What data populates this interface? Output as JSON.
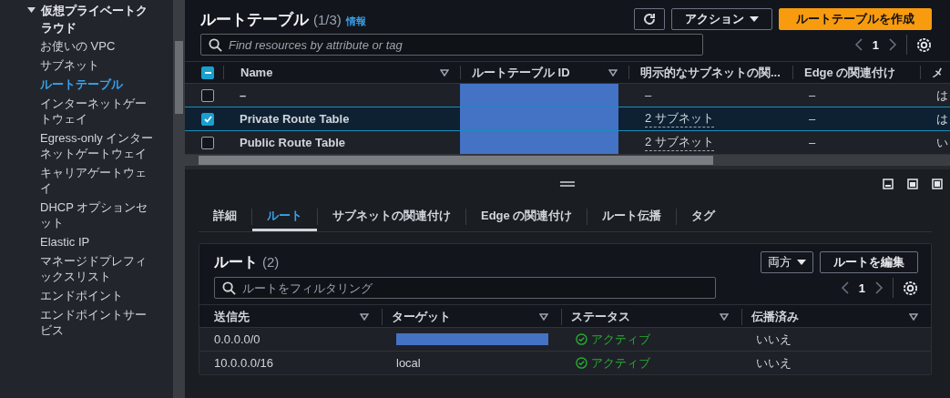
{
  "sidebar": {
    "group": {
      "label": "仮想プライベートクラウド",
      "expanded": true
    },
    "items": [
      {
        "label": "お使いの VPC",
        "selected": false
      },
      {
        "label": "サブネット",
        "selected": false
      },
      {
        "label": "ルートテーブル",
        "selected": true
      },
      {
        "label": "インターネットゲートウェイ",
        "selected": false
      },
      {
        "label": "Egress-only インターネットゲートウェイ",
        "selected": false
      },
      {
        "label": "キャリアゲートウェイ",
        "selected": false
      },
      {
        "label": "DHCP オプションセット",
        "selected": false
      },
      {
        "label": "Elastic IP",
        "selected": false
      },
      {
        "label": "マネージドプレフィックスリスト",
        "selected": false
      },
      {
        "label": "エンドポイント",
        "selected": false
      },
      {
        "label": "エンドポイントサービス",
        "selected": false
      }
    ]
  },
  "route_tables": {
    "title": "ルートテーブル",
    "count": "(1/3)",
    "info_link": "情報",
    "actions_button": "アクション",
    "create_button": "ルートテーブルを作成",
    "search": {
      "placeholder": "Find resources by attribute or tag"
    },
    "page": "1",
    "header_checkbox": {
      "indeterminate": true
    },
    "columns": [
      "Name",
      "ルートテーブル ID",
      "明示的なサブネットの関...",
      "Edge の関連付け",
      "メ"
    ],
    "rows": [
      {
        "name": "–",
        "subnets": "–",
        "subnets_link": false,
        "edge": "–",
        "column_6": "は",
        "checked": false,
        "selected": false
      },
      {
        "name": "Private Route Table",
        "subnets": "2 サブネット",
        "subnets_link": true,
        "edge": "–",
        "column_6": "は",
        "checked": true,
        "selected": true
      },
      {
        "name": "Public Route Table",
        "subnets": "2 サブネット",
        "subnets_link": true,
        "edge": "–",
        "column_6": "い",
        "checked": false,
        "selected": false
      }
    ]
  },
  "details": {
    "tabs": [
      {
        "label": "詳細",
        "selected": false
      },
      {
        "label": "ルート",
        "selected": true
      },
      {
        "label": "サブネットの関連付け",
        "selected": false
      },
      {
        "label": "Edge の関連付け",
        "selected": false
      },
      {
        "label": "ルート伝播",
        "selected": false
      },
      {
        "label": "タグ",
        "selected": false
      }
    ],
    "routes": {
      "title": "ルート",
      "count": "(2)",
      "filter_dropdown": "両方",
      "edit_button": "ルートを編集",
      "search": {
        "placeholder": "ルートをフィルタリング"
      },
      "page": "1",
      "columns": [
        "送信先",
        "ターゲット",
        "ステータス",
        "伝播済み"
      ],
      "rows": [
        {
          "destination": "0.0.0.0/0",
          "target": null,
          "status": "アクティブ",
          "propagated": "いいえ"
        },
        {
          "destination": "10.0.0.0/16",
          "target": "local",
          "status": "アクティブ",
          "propagated": "いいえ"
        }
      ]
    }
  }
}
